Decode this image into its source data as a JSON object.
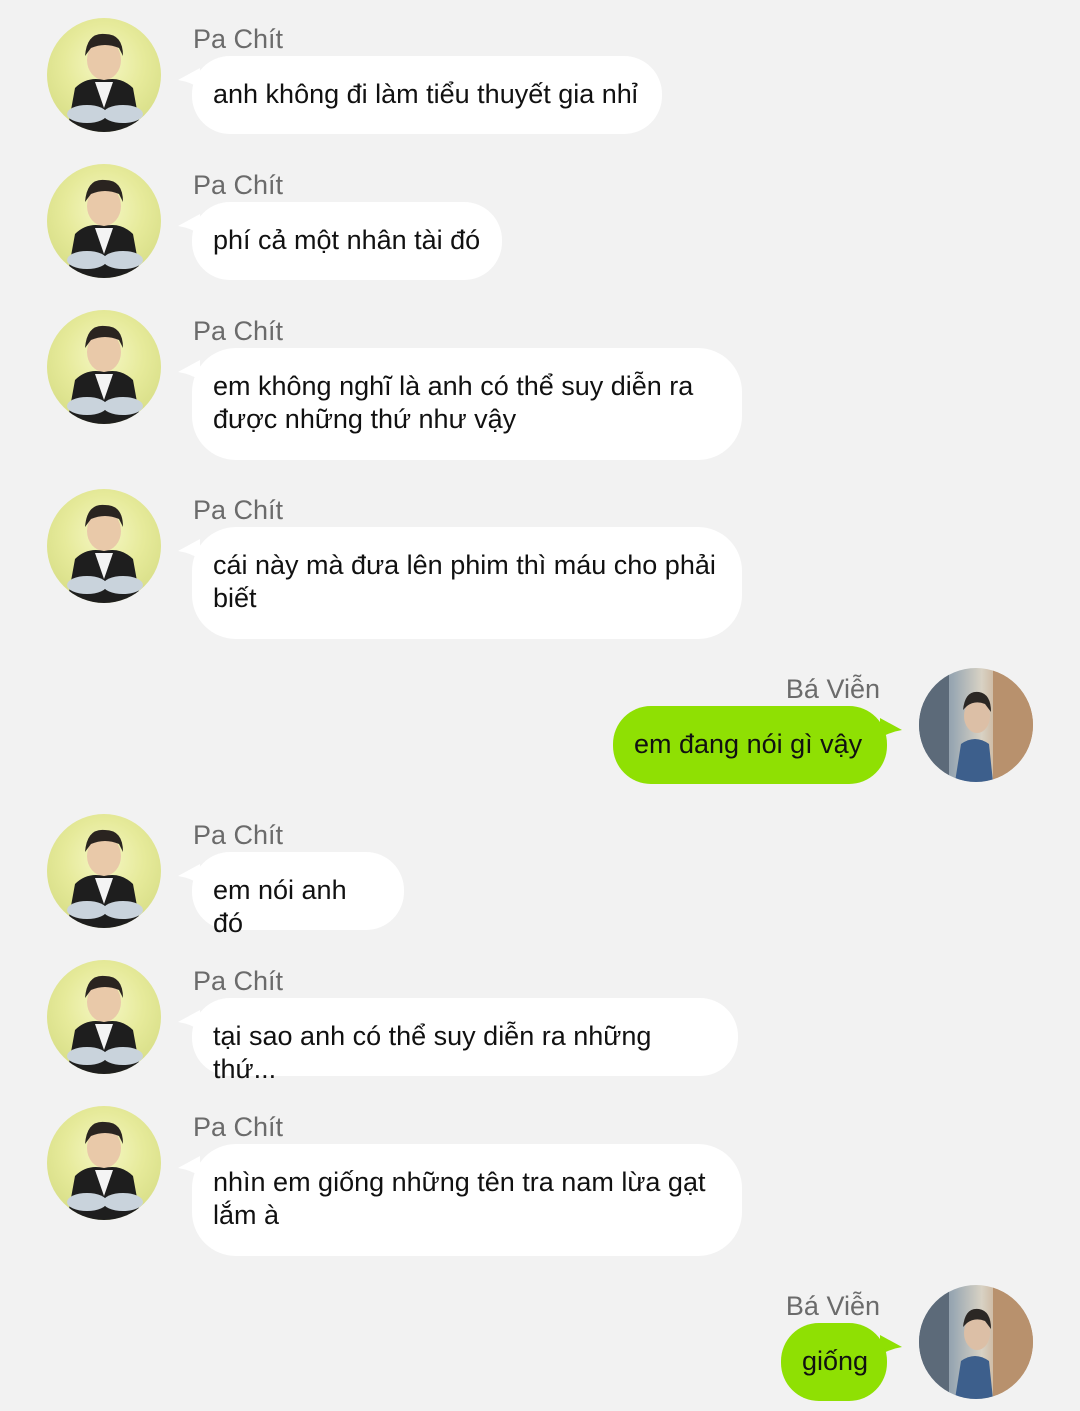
{
  "avatars": {
    "pa_chit": "person-photo-dark-jacket-icon",
    "ba_vien": "person-photo-profile-icon"
  },
  "colors": {
    "background": "#f2f2f2",
    "incoming_bubble": "#ffffff",
    "outgoing_bubble": "#8fe003",
    "sender_name": "#6b6b6b"
  },
  "messages": [
    {
      "sender": "Pa Chít",
      "side": "left",
      "text": "anh không đi làm tiểu thuyết gia nhỉ"
    },
    {
      "sender": "Pa Chít",
      "side": "left",
      "text": "phí cả một nhân tài đó"
    },
    {
      "sender": "Pa Chít",
      "side": "left",
      "text": "em không nghĩ là anh có thể suy diễn ra được những thứ như vậy"
    },
    {
      "sender": "Pa Chít",
      "side": "left",
      "text": "cái này mà đưa lên phim thì máu cho phải biết"
    },
    {
      "sender": "Bá Viễn",
      "side": "right",
      "text": "em đang nói gì vậy"
    },
    {
      "sender": "Pa Chít",
      "side": "left",
      "text": "em nói anh đó"
    },
    {
      "sender": "Pa Chít",
      "side": "left",
      "text": "tại sao anh có thể suy diễn ra những thứ..."
    },
    {
      "sender": "Pa Chít",
      "side": "left",
      "text": "nhìn em giống những tên tra nam lừa gạt lắm à"
    },
    {
      "sender": "Bá Viễn",
      "side": "right",
      "text": "giống"
    }
  ]
}
